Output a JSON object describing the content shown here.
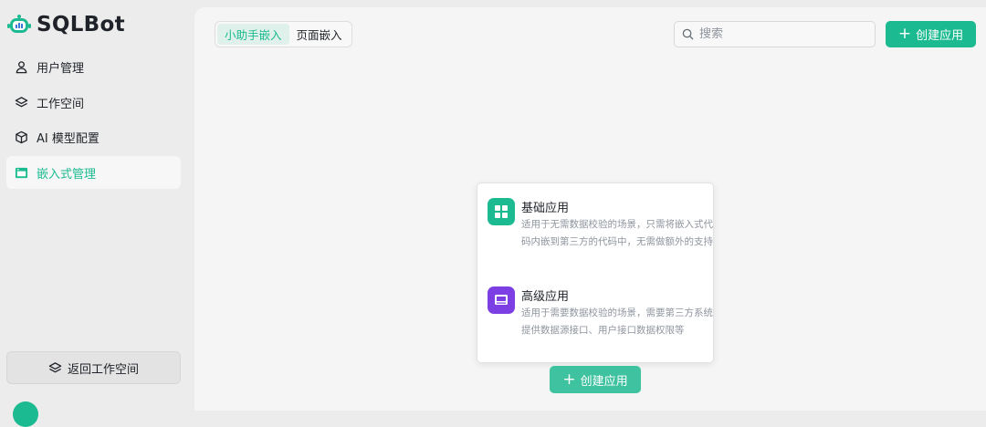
{
  "app": {
    "name": "SQLBot"
  },
  "sidebar": {
    "items": [
      {
        "label": "用户管理",
        "icon": "user-icon"
      },
      {
        "label": "工作空间",
        "icon": "layers-icon"
      },
      {
        "label": "AI 模型配置",
        "icon": "cube-icon"
      },
      {
        "label": "嵌入式管理",
        "icon": "embed-icon",
        "active": true
      }
    ],
    "back_label": "返回工作空间"
  },
  "toolbar": {
    "tabs": [
      {
        "label": "小助手嵌入",
        "active": true
      },
      {
        "label": "页面嵌入",
        "active": false
      }
    ],
    "search_placeholder": "搜索",
    "create_label": "创建应用"
  },
  "popover": {
    "options": [
      {
        "title": "基础应用",
        "desc": "适用于无需数据校验的场景，只需将嵌入式代码内嵌到第三方的代码中，无需做额外的支持",
        "icon": "grid-app-icon",
        "color": "#1cba90"
      },
      {
        "title": "高级应用",
        "desc": "适用于需要数据校验的场景，需要第三方系统提供数据源接口、用户接口数据权限等",
        "icon": "monitor-app-icon",
        "color": "#7b3fe4"
      }
    ]
  },
  "center": {
    "create_label": "创建应用"
  },
  "colors": {
    "accent": "#1cba90",
    "advanced": "#7b3fe4"
  }
}
